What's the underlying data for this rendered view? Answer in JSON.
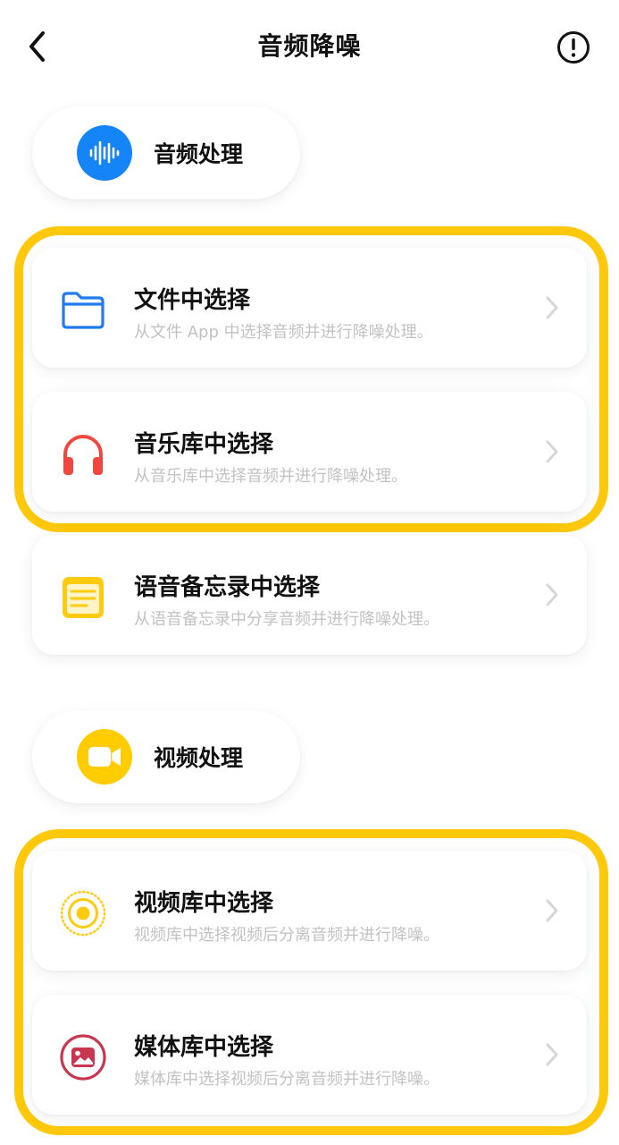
{
  "header": {
    "title": "音频降噪"
  },
  "sections": [
    {
      "label": "音频处理",
      "items": [
        {
          "title": "文件中选择",
          "subtitle": "从文件 App 中选择音频并进行降噪处理。"
        },
        {
          "title": "音乐库中选择",
          "subtitle": "从音乐库中选择音频并进行降噪处理。"
        },
        {
          "title": "语音备忘录中选择",
          "subtitle": "从语音备忘录中分享音频并进行降噪处理。"
        }
      ]
    },
    {
      "label": "视频处理",
      "items": [
        {
          "title": "视频库中选择",
          "subtitle": "视频库中选择视频后分离音频并进行降噪。"
        },
        {
          "title": "媒体库中选择",
          "subtitle": "媒体库中选择视频后分离音频并进行降噪。"
        }
      ]
    }
  ],
  "colors": {
    "highlight": "#FFC80A",
    "audio_badge": "#1584F7",
    "video_badge": "#FFCC00",
    "folder_icon": "#1E7CF0",
    "headphones_icon": "#F0483E",
    "notes_icon": "#FFCB0F",
    "media_icon": "#C9364F"
  },
  "icons": {
    "back": "chevron-left-icon",
    "info": "info-icon",
    "audio_badge": "waveform-icon",
    "video_badge": "video-camera-icon",
    "items": [
      "folder-icon",
      "headphones-icon",
      "notes-icon",
      "live-photo-icon",
      "photo-icon"
    ]
  }
}
